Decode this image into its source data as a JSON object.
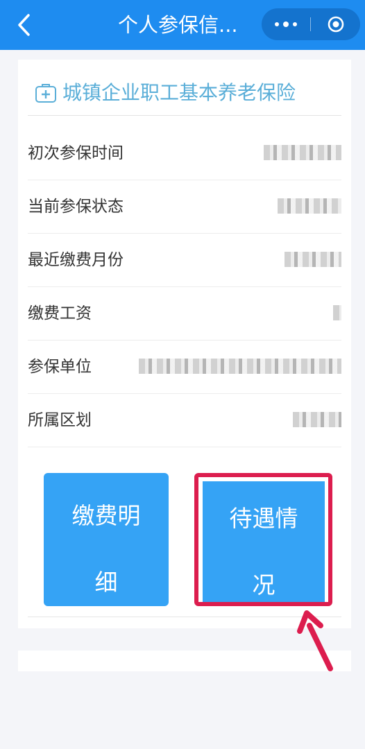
{
  "topbar": {
    "title": "个人参保信...",
    "back_icon": "chevron-left-icon",
    "more_icon": "more-dots-icon",
    "close_icon": "target-circle-icon",
    "color": "#1e8cf0"
  },
  "card": {
    "header_icon": "medical-kit-icon",
    "header_title": "城镇企业职工基本养老保险",
    "rows": [
      {
        "label": "初次参保时间",
        "value": ""
      },
      {
        "label": "当前参保状态",
        "value": ""
      },
      {
        "label": "最近缴费月份",
        "value": ""
      },
      {
        "label": "缴费工资",
        "value": ""
      },
      {
        "label": "参保单位",
        "value": ""
      },
      {
        "label": "所属区划",
        "value": ""
      }
    ],
    "buttons": {
      "payment_detail": "缴费明细",
      "benefit_status": "待遇情况"
    }
  },
  "annotation": {
    "highlight_color": "#dc1d4e",
    "arrow_icon": "pointer-arrow-icon"
  }
}
